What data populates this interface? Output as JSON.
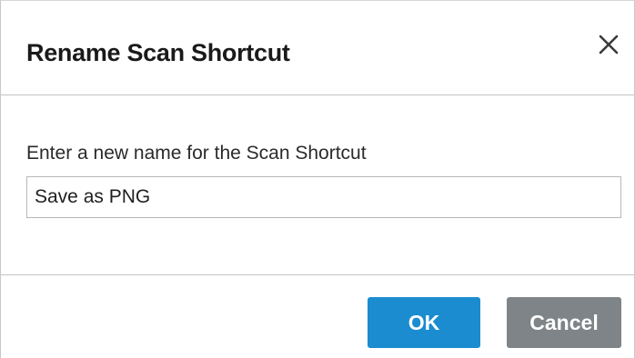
{
  "dialog": {
    "title": "Rename Scan Shortcut",
    "close_icon": "close-icon",
    "prompt": "Enter a new name for the Scan Shortcut",
    "name_input": {
      "value": "Save as PNG"
    },
    "buttons": {
      "ok_label": "OK",
      "cancel_label": "Cancel"
    }
  },
  "colors": {
    "ok_button": "#1b8ccf",
    "cancel_button": "#7e8487",
    "divider": "#c4c4c4"
  }
}
